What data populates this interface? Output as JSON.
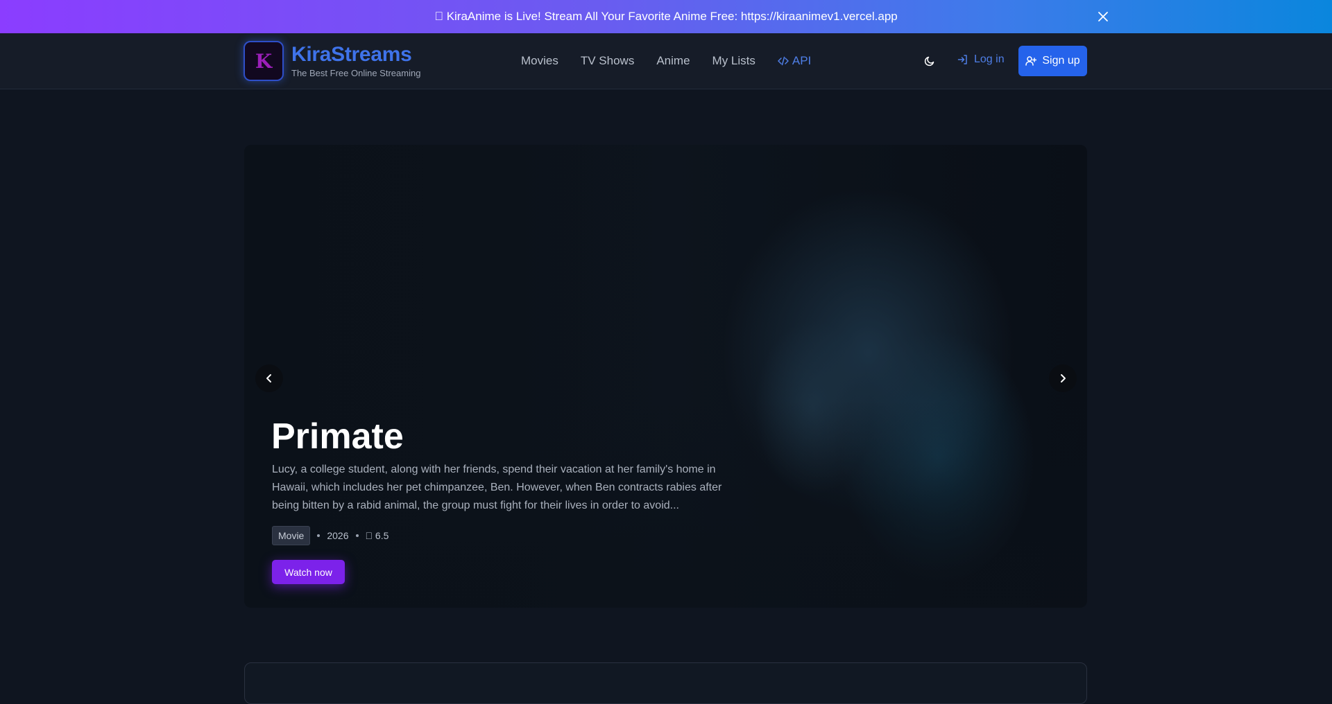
{
  "announcement": {
    "text": "\u0000 KiraAnime is Live! Stream All Your Favorite Anime Free: https://kiraanimev1.vercel.app",
    "close_icon": "close-icon"
  },
  "brand": {
    "logo_letter": "K",
    "title": "KiraStreams",
    "subtitle": "The Best Free Online Streaming",
    "title_color": "#3f73ea"
  },
  "nav": {
    "movies": "Movies",
    "tv_shows": "TV Shows",
    "anime": "Anime",
    "my_lists": "My Lists",
    "api": "API"
  },
  "actions": {
    "theme_icon": "moon-icon",
    "login": "Log in",
    "signup": "Sign up",
    "signup_color": "#2563eb"
  },
  "hero": {
    "title": "Primate",
    "description": "Lucy, a college student, along with her friends, spend their vacation at her family's home in Hawaii, which includes her pet chimpanzee, Ben. However, when Ben contracts rabies after being bitten by a rabid animal, the group must fight for their lives in order to avoid...",
    "type": "Movie",
    "year": "2026",
    "rating": "\u0000 6.5",
    "watch_label": "Watch now",
    "accent": "#7c22ea"
  }
}
